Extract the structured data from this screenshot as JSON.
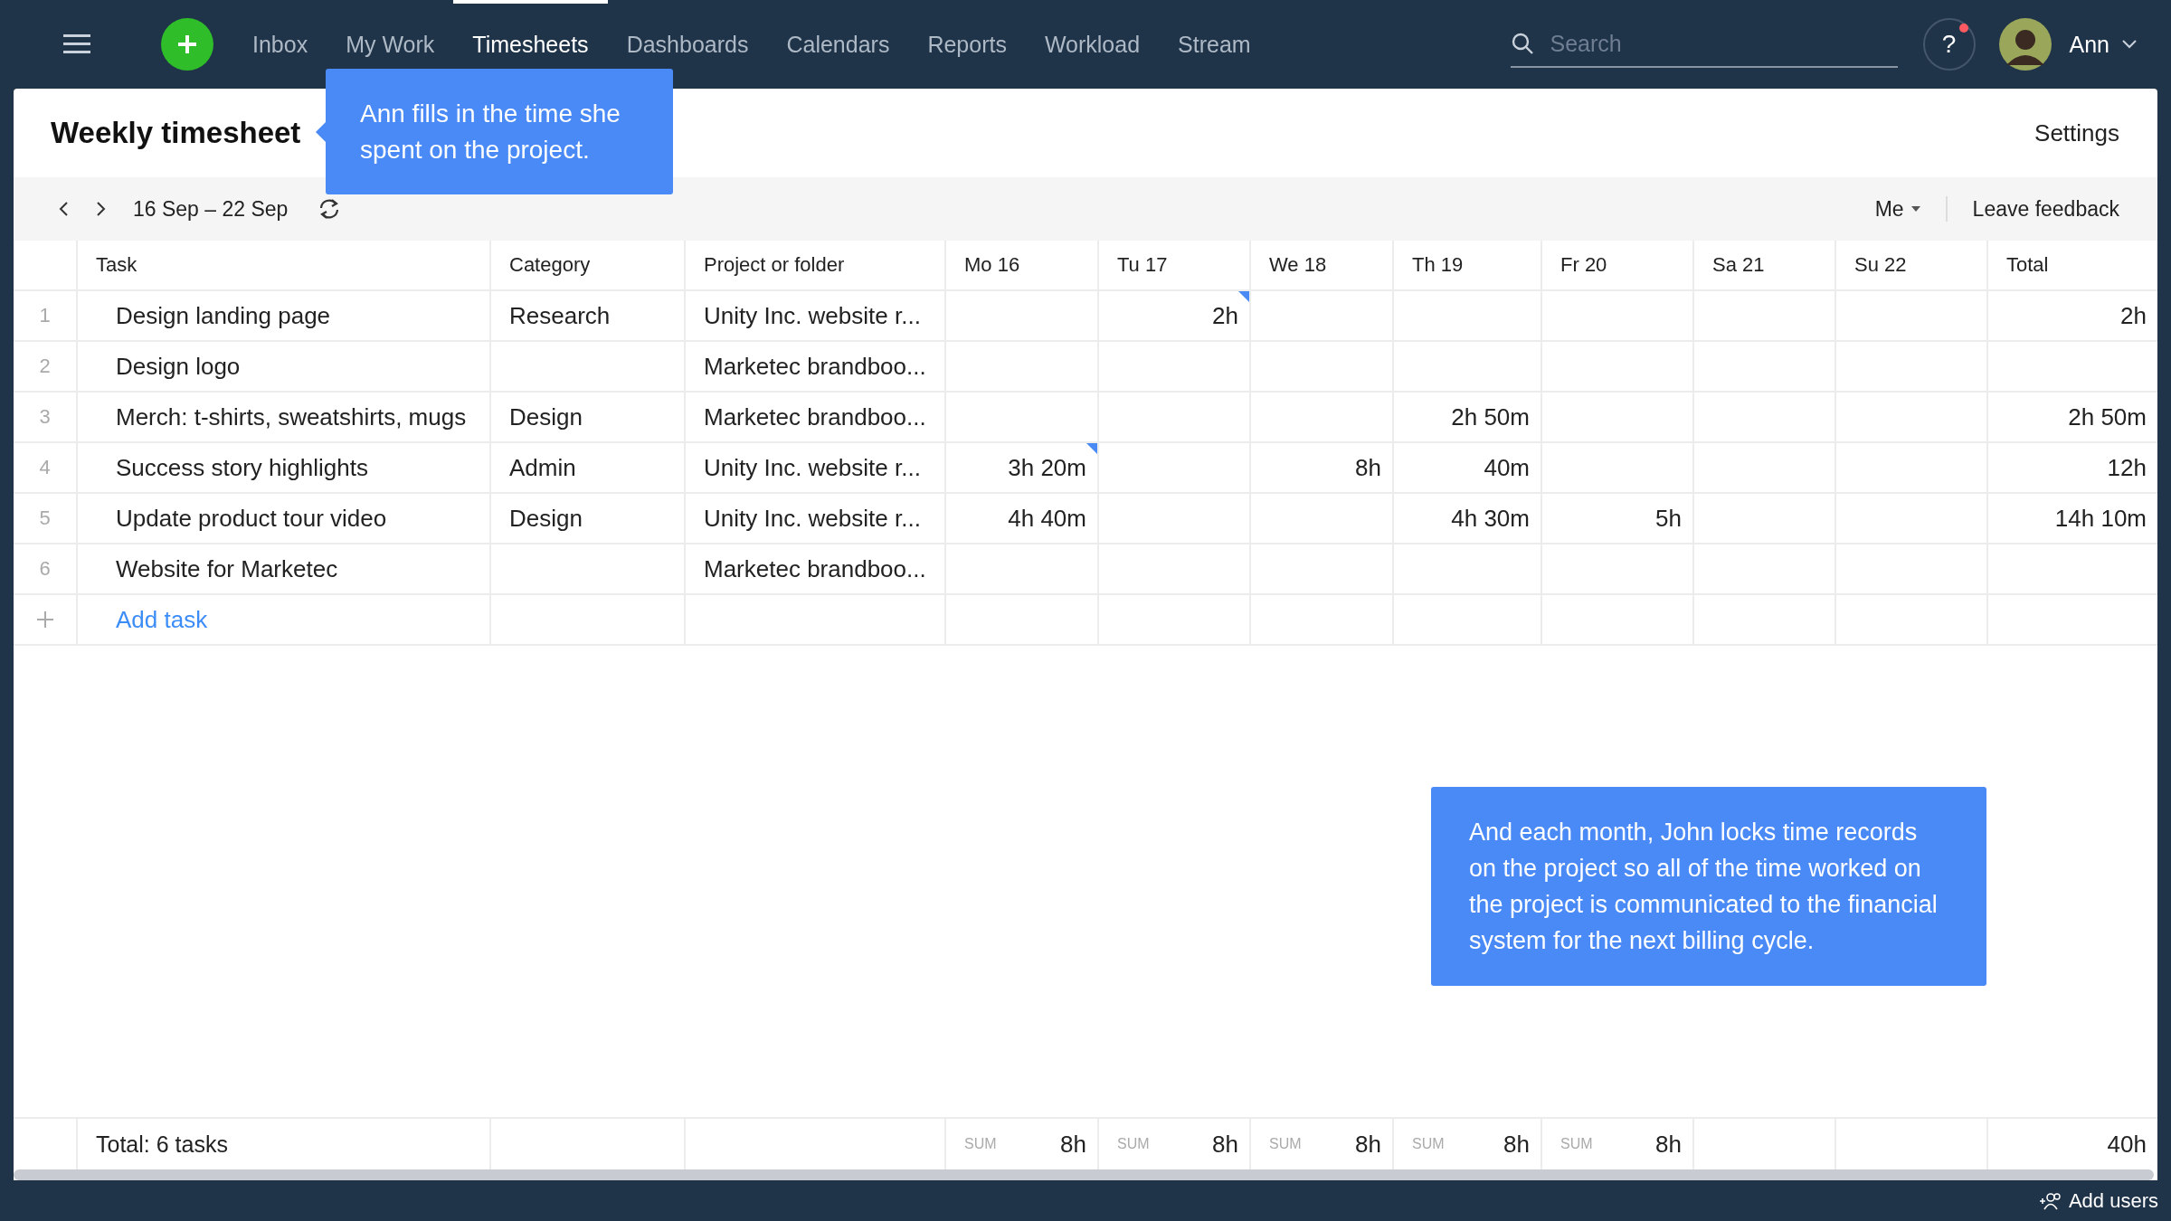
{
  "top_bar": {
    "nav": [
      {
        "label": "Inbox",
        "selected": false
      },
      {
        "label": "My Work",
        "selected": false
      },
      {
        "label": "Timesheets",
        "selected": true
      },
      {
        "label": "Dashboards",
        "selected": false
      },
      {
        "label": "Calendars",
        "selected": false
      },
      {
        "label": "Reports",
        "selected": false
      },
      {
        "label": "Workload",
        "selected": false
      },
      {
        "label": "Stream",
        "selected": false
      }
    ],
    "search": {
      "placeholder": "Search"
    },
    "help": {
      "label": "?",
      "notification": true
    },
    "user": {
      "name": "Ann"
    }
  },
  "page": {
    "title": "Weekly timesheet",
    "settings": "Settings"
  },
  "toolbar": {
    "date_range": "16 Sep – 22 Sep",
    "filter": "Me",
    "feedback": "Leave feedback"
  },
  "table": {
    "columns": [
      "Task",
      "Category",
      "Project or folder",
      "Mo 16",
      "Tu 17",
      "We 18",
      "Th 19",
      "Fr 20",
      "Sa 21",
      "Su 22",
      "Total"
    ],
    "rows": [
      {
        "number": "1",
        "task": "Design landing page",
        "category": "Research",
        "project": "Unity Inc. website r...",
        "days": [
          {
            "marked": false
          },
          {
            "value": "2h",
            "marked": true
          },
          {
            "marked": false
          },
          {
            "marked": false
          },
          {
            "marked": false
          },
          {
            "marked": false
          },
          {
            "marked": false
          }
        ],
        "total": "2h"
      },
      {
        "number": "2",
        "task": "Design logo",
        "project": "Marketec brandboo...",
        "days": [
          {
            "marked": false
          },
          {
            "marked": false
          },
          {
            "marked": false
          },
          {
            "marked": false
          },
          {
            "marked": false
          },
          {
            "marked": false
          },
          {
            "marked": false
          }
        ]
      },
      {
        "number": "3",
        "task": "Merch: t-shirts, sweatshirts, mugs",
        "category": "Design",
        "project": "Marketec brandboo...",
        "days": [
          {
            "marked": false
          },
          {
            "marked": false
          },
          {
            "marked": false
          },
          {
            "value": "2h 50m",
            "marked": false
          },
          {
            "marked": false
          },
          {
            "marked": false
          },
          {
            "marked": false
          }
        ],
        "total": "2h 50m"
      },
      {
        "number": "4",
        "task": "Success story highlights",
        "category": "Admin",
        "project": "Unity Inc. website r...",
        "days": [
          {
            "value": "3h 20m",
            "marked": true
          },
          {
            "marked": false
          },
          {
            "value": "8h",
            "marked": false
          },
          {
            "value": "40m",
            "marked": false
          },
          {
            "marked": false
          },
          {
            "marked": false
          },
          {
            "marked": false
          }
        ],
        "total": "12h"
      },
      {
        "number": "5",
        "task": "Update product tour video",
        "category": "Design",
        "project": "Unity Inc. website r...",
        "days": [
          {
            "value": "4h 40m",
            "marked": false
          },
          {
            "marked": false
          },
          {
            "marked": false
          },
          {
            "value": "4h 30m",
            "marked": false
          },
          {
            "value": "5h",
            "marked": false
          },
          {
            "marked": false
          },
          {
            "marked": false
          }
        ],
        "total": "14h 10m"
      },
      {
        "number": "6",
        "task": "Website for Marketec",
        "project": "Marketec brandboo...",
        "days": [
          {
            "marked": false
          },
          {
            "marked": false
          },
          {
            "marked": false
          },
          {
            "marked": false
          },
          {
            "marked": false
          },
          {
            "marked": false
          },
          {
            "marked": false
          }
        ]
      }
    ],
    "add_task": "Add task"
  },
  "footer": {
    "label": "Total: 6 tasks",
    "sums": [
      {
        "label": "SUM",
        "value": "8h"
      },
      {
        "label": "SUM",
        "value": "8h"
      },
      {
        "label": "SUM",
        "value": "8h"
      },
      {
        "label": "SUM",
        "value": "8h"
      },
      {
        "label": "SUM",
        "value": "8h"
      }
    ],
    "total": "40h"
  },
  "callouts": [
    {
      "kind": "pointer",
      "text": "Ann fills in the time she spent on the project."
    },
    {
      "kind": "plain",
      "text": "And each month, John locks time records on the project so all of the time worked on the project is communicated to the financial system for the next billing cycle."
    }
  ],
  "bottom_bar": {
    "add_users": "Add users"
  }
}
